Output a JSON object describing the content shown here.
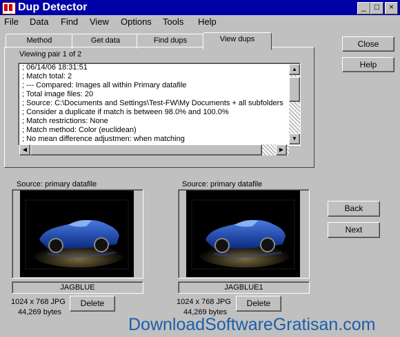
{
  "window": {
    "title": "Dup Detector",
    "buttons": [
      "_",
      "□",
      "×"
    ]
  },
  "menu": [
    "File",
    "Data",
    "Find",
    "View",
    "Options",
    "Tools",
    "Help"
  ],
  "tabs": [
    "Method",
    "Get data",
    "Find dups",
    "View dups"
  ],
  "active_tab": "View dups",
  "viewing_label": "Viewing pair 1 of 2",
  "log_lines": [
    "; 06/14/06 18:31:51",
    "; Match total: 2",
    "; --- Compared: Images all within Primary datafile",
    "; Total image files: 20",
    "; Source: C:\\Documents and Settings\\Test-FW\\My Documents + all subfolders",
    "; Consider a duplicate if match is between 98.0% and 100.0%",
    "; Match restrictions: None",
    "; Match method: Color (euclidean)",
    "; No mean difference adjustmen: when matching"
  ],
  "buttons": {
    "close": "Close",
    "help": "Help",
    "back": "Back",
    "next": "Next"
  },
  "left_image": {
    "source": "Source: primary datafile",
    "name": "JAGBLUE",
    "dims": "1024 x 768 JPG",
    "size": "44,269 bytes",
    "delete": "Delete"
  },
  "right_image": {
    "source": "Source: primary datafile",
    "name": "JAGBLUE1",
    "dims": "1024 x 768 JPG",
    "size": "44,269 bytes",
    "delete": "Delete"
  },
  "watermark": "DownloadSoftwareGratisan.com"
}
